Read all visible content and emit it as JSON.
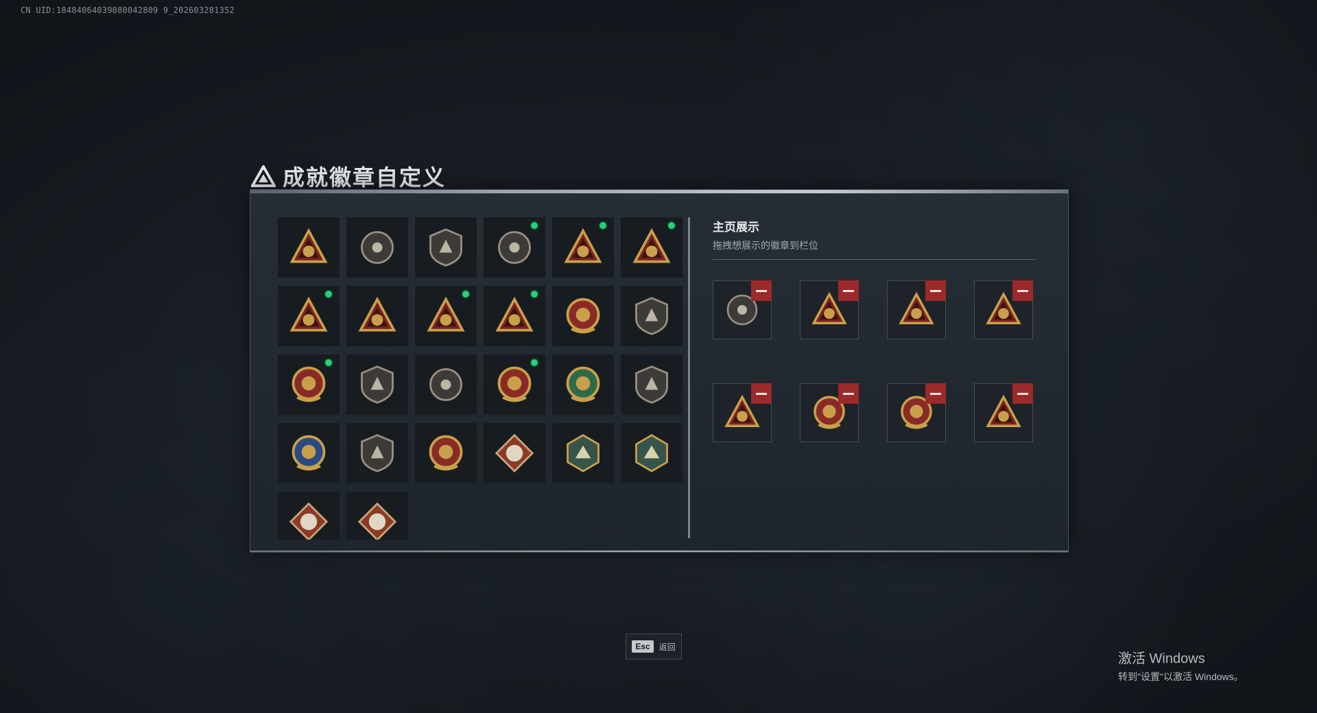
{
  "uid_text": "CN UID:18484064039080042809 9_202603281352",
  "window": {
    "title": "成就徽章自定义"
  },
  "badges": [
    {
      "name": "shield-triangle-icon",
      "new": false
    },
    {
      "name": "helicopter-icon",
      "new": false
    },
    {
      "name": "jet-shield-icon",
      "new": false
    },
    {
      "name": "money-bag-55-icon",
      "new": true
    },
    {
      "name": "medal-triangle-icon",
      "new": true
    },
    {
      "name": "trophy-triangle-icon",
      "new": true
    },
    {
      "name": "hand-coins-triangle-icon",
      "new": true
    },
    {
      "name": "number-one-triangle-icon",
      "new": false
    },
    {
      "name": "usb-drive-triangle-icon",
      "new": true
    },
    {
      "name": "soldier-squad-triangle-icon",
      "new": true
    },
    {
      "name": "star-emblem-icon",
      "new": false
    },
    {
      "name": "down-arrow-shield-icon",
      "new": false
    },
    {
      "name": "star-crest-shield-icon",
      "new": true
    },
    {
      "name": "gem-shield-icon",
      "new": false
    },
    {
      "name": "crosshair-icon",
      "new": false
    },
    {
      "name": "flower-emblem-icon",
      "new": true
    },
    {
      "name": "tank-emblem-icon",
      "new": false
    },
    {
      "name": "crossed-rifle-shield-icon",
      "new": false
    },
    {
      "name": "sniper-crest-icon",
      "new": false
    },
    {
      "name": "rifle-crossed-shield-icon",
      "new": false
    },
    {
      "name": "crossed-rifles-emblem-icon",
      "new": false
    },
    {
      "name": "wolf-diamond-icon",
      "new": false
    },
    {
      "name": "dragonfly-hex-icon",
      "new": false
    },
    {
      "name": "tools-hex-icon",
      "new": false
    },
    {
      "name": "dragon-diamond-icon",
      "new": false
    },
    {
      "name": "runner-diamond-icon",
      "new": false
    }
  ],
  "showcase": {
    "title": "主页展示",
    "subtitle": "拖拽想展示的徽章到栏位",
    "slots": [
      {
        "badge": "money-bag-55-icon"
      },
      {
        "badge": "usb-drive-triangle-icon"
      },
      {
        "badge": "medal-triangle-icon"
      },
      {
        "badge": "trophy-triangle-icon"
      },
      {
        "badge": "hand-coins-triangle-icon"
      },
      {
        "badge": "star-crest-shield-icon"
      },
      {
        "badge": "flower-emblem-icon"
      },
      {
        "badge": "soldier-squad-triangle-icon"
      }
    ]
  },
  "footer": {
    "esc_key": "Esc",
    "esc_label": "返回"
  },
  "watermark": {
    "line1": "激活 Windows",
    "line2": "转到\"设置\"以激活 Windows。"
  },
  "colors": {
    "accent_new": "#27d07a",
    "remove": "#9c2a2a",
    "gold": "#c9a04a",
    "badge_red": "#7a2220"
  }
}
